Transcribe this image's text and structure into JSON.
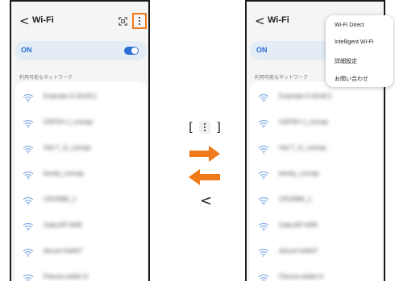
{
  "left_screen": {
    "back_glyph": "<",
    "title": "Wi-Fi",
    "on_label": "ON",
    "section_label": "利用可能なネットワーク",
    "networks": [
      "Extenda-G-5G4C1",
      "G5F5H-J_comap",
      "Hal-T_G_comap",
      "kendy_comap",
      "CR1RB6_1",
      "GakuAP-6/85",
      "docum-kafet7",
      "Flavoru-kafet-G"
    ]
  },
  "right_screen": {
    "back_glyph": "<",
    "title": "Wi-Fi",
    "on_label": "ON",
    "section_label": "利用可能なネットワーク",
    "networks": [
      "Extenda-G-5G4C1",
      "G5F5H-J_comap",
      "Hal-T_G_comap",
      "kendy_comap",
      "CR1RB6_1",
      "GakuAP-6/85",
      "docum-kafet7",
      "Flavoru-kafet-G"
    ],
    "menu": [
      "Wi-Fi Direct",
      "Intelligent Wi-Fi",
      "詳細設定",
      "お問い合わせ"
    ]
  },
  "legend": {
    "key_open": "[",
    "key_close": "]",
    "back_symbol": "<"
  },
  "colors": {
    "accent_orange": "#f07a1a",
    "toggle_blue": "#2a6fd6"
  },
  "icons": {
    "more": "more-options-icon",
    "scan": "qr-scan-icon",
    "network": "wifi-signal-icon",
    "forward": "arrow-right-icon",
    "backward": "arrow-left-icon"
  }
}
